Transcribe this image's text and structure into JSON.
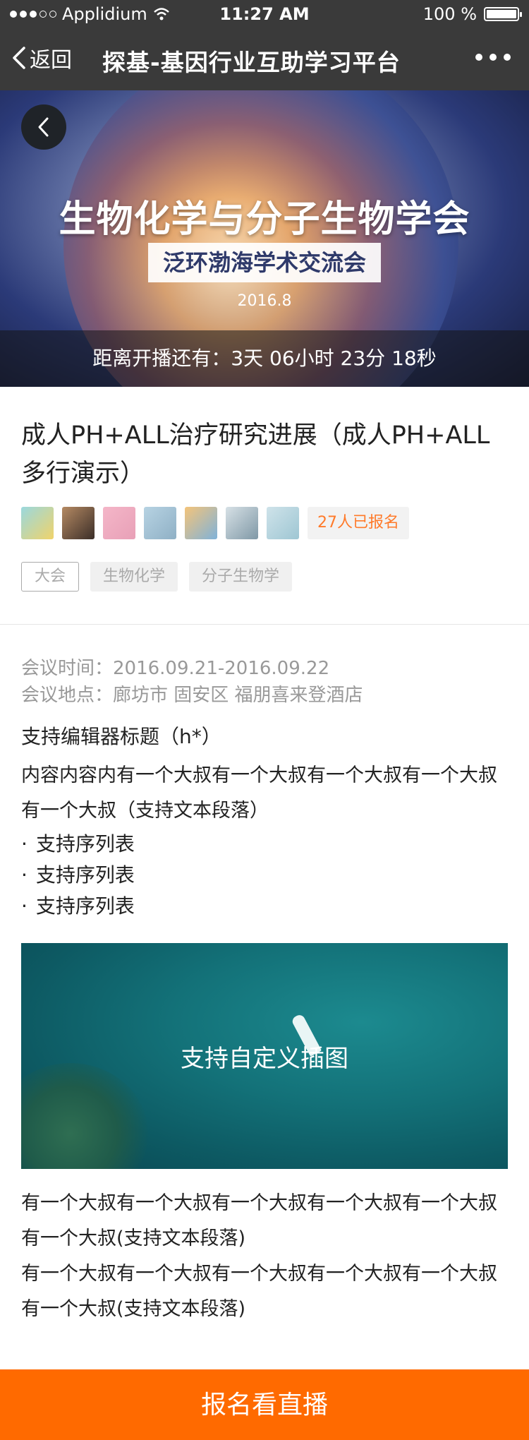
{
  "status_bar": {
    "carrier": "Applidium",
    "time": "11:27 AM",
    "battery": "100 %"
  },
  "nav": {
    "back_label": "返回",
    "title": "探基-基因行业互助学习平台"
  },
  "banner": {
    "title": "生物化学与分子生物学会",
    "subtitle": "泛环渤海学术交流会",
    "date": "2016.8",
    "countdown": "距离开播还有：3天 06小时 23分 18秒"
  },
  "article": {
    "title": "成人PH+ALL治疗研究进展（成人PH+ALL多行演示）",
    "registered": "27人已报名",
    "tags": [
      "大会",
      "生物化学",
      "分子生物学"
    ],
    "meta": {
      "time": "会议时间：2016.09.21-2016.09.22",
      "place": "会议地点：廊坊市 固安区 福朋喜来登酒店"
    },
    "heading": "支持编辑器标题（h*）",
    "paragraph1": "内容内容内有一个大叔有一个大叔有一个大叔有一个大叔有一个大叔（支持文本段落）",
    "list": [
      "支持序列表",
      "支持序列表",
      "支持序列表"
    ],
    "figure_caption": "支持自定义插图",
    "paragraph2": "有一个大叔有一个大叔有一个大叔有一个大叔有一个大叔有一个大叔(支持文本段落)",
    "paragraph3": "有一个大叔有一个大叔有一个大叔有一个大叔有一个大叔有一个大叔(支持文本段落)"
  },
  "cta": {
    "label": "报名看直播",
    "color": "#ff6a00"
  },
  "colors": {
    "accent": "#ff7a2a",
    "nav_bg": "#3a3a3a"
  }
}
